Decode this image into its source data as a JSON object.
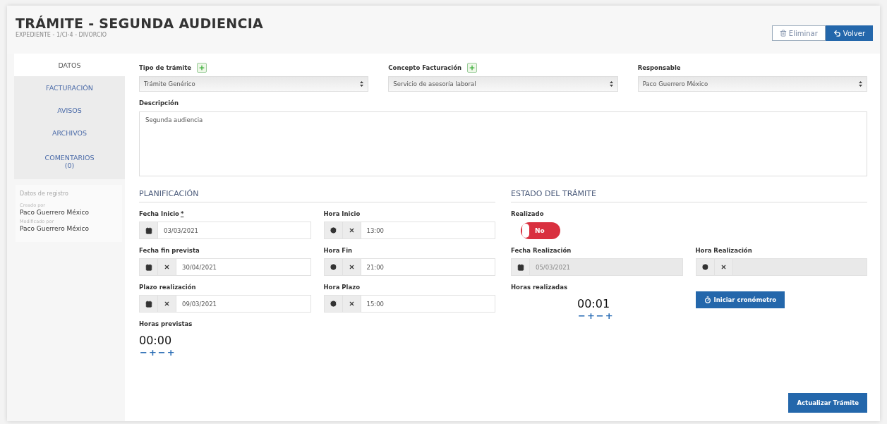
{
  "header": {
    "title": "TRÁMITE - SEGUNDA AUDIENCIA",
    "subtitle": "EXPEDIENTE - 1/CI-4 - DIVORCIO",
    "buttons": [
      {
        "label": "Eliminar",
        "kind": "outline"
      },
      {
        "label": "Volver",
        "kind": "primary"
      }
    ]
  },
  "sidebar": {
    "tabs": [
      {
        "label": "DATOS",
        "selected": true
      },
      {
        "label": "FACTURACIÓN",
        "selected": false
      },
      {
        "label": "AVISOS",
        "selected": false
      },
      {
        "label": "ARCHIVOS",
        "selected": false
      },
      {
        "label": "COMENTARIOS",
        "count": "(0)",
        "selected": false
      }
    ],
    "registro": {
      "title": "Datos de registro",
      "entries": [
        {
          "label": "Creado por",
          "value": "Paco Guerrero México"
        },
        {
          "label": "Modificado por",
          "value": "Paco Guerrero México"
        }
      ]
    }
  },
  "form": {
    "selects": [
      {
        "label": "Tipo de trámite",
        "addable": true,
        "value": "Trámite Genérico"
      },
      {
        "label": "Concepto Facturación",
        "addable": true,
        "value": "Servicio de asesoría laboral"
      },
      {
        "label": "Responsable",
        "addable": false,
        "value": "Paco Guerrero México"
      }
    ],
    "description": {
      "label": "Descripción",
      "value": "Segunda audiencia"
    },
    "planning": {
      "title": "PLANIFICACIÓN",
      "fields": [
        {
          "label": "Fecha Inicio",
          "required_mark": "*",
          "kind": "date",
          "clearable": false,
          "disabled": false,
          "value": "03/03/2021"
        },
        {
          "label": "Hora Inicio",
          "kind": "time",
          "clearable": true,
          "disabled": false,
          "value": "13:00"
        },
        {
          "label": "Fecha fin prevista",
          "kind": "date",
          "clearable": true,
          "disabled": false,
          "value": "30/04/2021"
        },
        {
          "label": "Hora Fin",
          "kind": "time",
          "clearable": true,
          "disabled": false,
          "value": "21:00"
        },
        {
          "label": "Plazo realización",
          "kind": "date",
          "clearable": true,
          "disabled": false,
          "value": "09/03/2021"
        },
        {
          "label": "Hora Plazo",
          "kind": "time",
          "clearable": true,
          "disabled": false,
          "value": "15:00"
        }
      ],
      "counter": {
        "label": "Horas previstas",
        "value": "00:00",
        "controls": [
          {
            "symbol": "−"
          },
          {
            "symbol": "+"
          },
          {
            "symbol": "−"
          },
          {
            "symbol": "+"
          }
        ]
      }
    },
    "status": {
      "title": "ESTADO DEL TRÁMITE",
      "done": {
        "label": "Realizado",
        "on": false,
        "text": "No"
      },
      "fields": [
        {
          "label": "Fecha Realización",
          "kind": "date",
          "clearable": false,
          "disabled": true,
          "value": "05/03/2021"
        },
        {
          "label": "Hora Realización",
          "kind": "time",
          "clearable": true,
          "disabled": true
        }
      ],
      "counter": {
        "label": "Horas realizadas",
        "value": "00:01",
        "controls": [
          {
            "symbol": "−"
          },
          {
            "symbol": "+"
          },
          {
            "symbol": "−"
          },
          {
            "symbol": "+"
          }
        ]
      },
      "timer_button": "Iniciar cronómetro"
    },
    "submit": "Actualizar Trámite"
  }
}
